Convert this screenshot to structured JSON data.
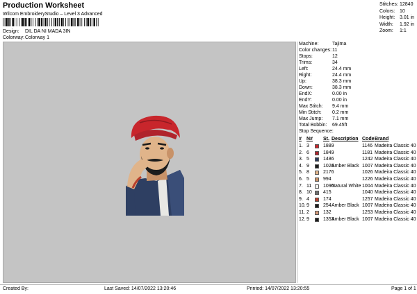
{
  "header": {
    "title": "Production Worksheet",
    "subtitle": "Wilcom EmbroideryStudio – Level 3 Advanced",
    "design_label": "Design:",
    "design_value": "DIL DA NI MADA 3IN",
    "colorway_label": "Colorway:",
    "colorway_value": "Colorway 1"
  },
  "top_stats": [
    {
      "k": "Stitches:",
      "v": "12840"
    },
    {
      "k": "Colors:",
      "v": "10"
    },
    {
      "k": "Height:",
      "v": "3.01 in"
    },
    {
      "k": "Width:",
      "v": "1.92 in"
    },
    {
      "k": "Zoom:",
      "v": "1:1"
    }
  ],
  "details": [
    {
      "k": "Machine:",
      "v": "Tajima"
    },
    {
      "k": "Color changes:",
      "v": "11"
    },
    {
      "k": "Stops:",
      "v": "12"
    },
    {
      "k": "Trims:",
      "v": "34"
    },
    {
      "k": "Left:",
      "v": "24.4 mm"
    },
    {
      "k": "Right:",
      "v": "24.4 mm"
    },
    {
      "k": "Up:",
      "v": "38.3 mm"
    },
    {
      "k": "Down:",
      "v": "38.3 mm"
    },
    {
      "k": "EndX:",
      "v": "0.00 in"
    },
    {
      "k": "EndY:",
      "v": "0.00 in"
    },
    {
      "k": "Max Stitch:",
      "v": "9.4 mm"
    },
    {
      "k": "Min Stitch:",
      "v": "0.2 mm"
    },
    {
      "k": "Max Jump:",
      "v": "7.1 mm"
    },
    {
      "k": "Total Bobbin:",
      "v": "69.45ft"
    }
  ],
  "stop_sequence": {
    "title": "Stop Sequence:",
    "headers": {
      "num": "#",
      "n": "N#",
      "st": "St.",
      "desc": "Description",
      "code": "Code",
      "brand": "Brand"
    },
    "rows": [
      {
        "num": "1.",
        "n": "3",
        "color": "#c8262c",
        "st": "1889",
        "desc": "",
        "code": "1146",
        "brand": "Madeira Classic 40"
      },
      {
        "num": "2.",
        "n": "6",
        "color": "#b0242c",
        "st": "1849",
        "desc": "",
        "code": "1181",
        "brand": "Madeira Classic 40"
      },
      {
        "num": "3.",
        "n": "5",
        "color": "#2b3b5c",
        "st": "1486",
        "desc": "",
        "code": "1242",
        "brand": "Madeira Classic 40"
      },
      {
        "num": "4.",
        "n": "9",
        "color": "#1c1c1c",
        "st": "1026",
        "desc": "Amber Black",
        "code": "1007",
        "brand": "Madeira Classic 40"
      },
      {
        "num": "5.",
        "n": "8",
        "color": "#e0b48a",
        "st": "2176",
        "desc": "",
        "code": "1026",
        "brand": "Madeira Classic 40"
      },
      {
        "num": "6.",
        "n": "5",
        "color": "#c89268",
        "st": "994",
        "desc": "",
        "code": "1226",
        "brand": "Madeira Classic 40"
      },
      {
        "num": "7.",
        "n": "11",
        "color": "#f4f4f0",
        "st": "1090",
        "desc": "Natural White",
        "code": "1004",
        "brand": "Madeira Classic 40"
      },
      {
        "num": "8.",
        "n": "10",
        "color": "#6e6e6e",
        "st": "415",
        "desc": "",
        "code": "1040",
        "brand": "Madeira Classic 40"
      },
      {
        "num": "9.",
        "n": "4",
        "color": "#b8402c",
        "st": "174",
        "desc": "",
        "code": "1257",
        "brand": "Madeira Classic 40"
      },
      {
        "num": "10.",
        "n": "9",
        "color": "#1c1c1c",
        "st": "254",
        "desc": "Amber Black",
        "code": "1007",
        "brand": "Madeira Classic 40"
      },
      {
        "num": "11.",
        "n": "2",
        "color": "#d49a7a",
        "st": "132",
        "desc": "",
        "code": "1253",
        "brand": "Madeira Classic 40"
      },
      {
        "num": "12.",
        "n": "9",
        "color": "#1c1c1c",
        "st": "1353",
        "desc": "Amber Black",
        "code": "1007",
        "brand": "Madeira Classic 40"
      }
    ]
  },
  "footer": {
    "created_by": "Created By:",
    "last_saved": "Last Saved: 14/07/2022 13:20:46",
    "printed": "Printed: 14/07/2022 13:20:55",
    "page": "Page 1 of 1"
  }
}
